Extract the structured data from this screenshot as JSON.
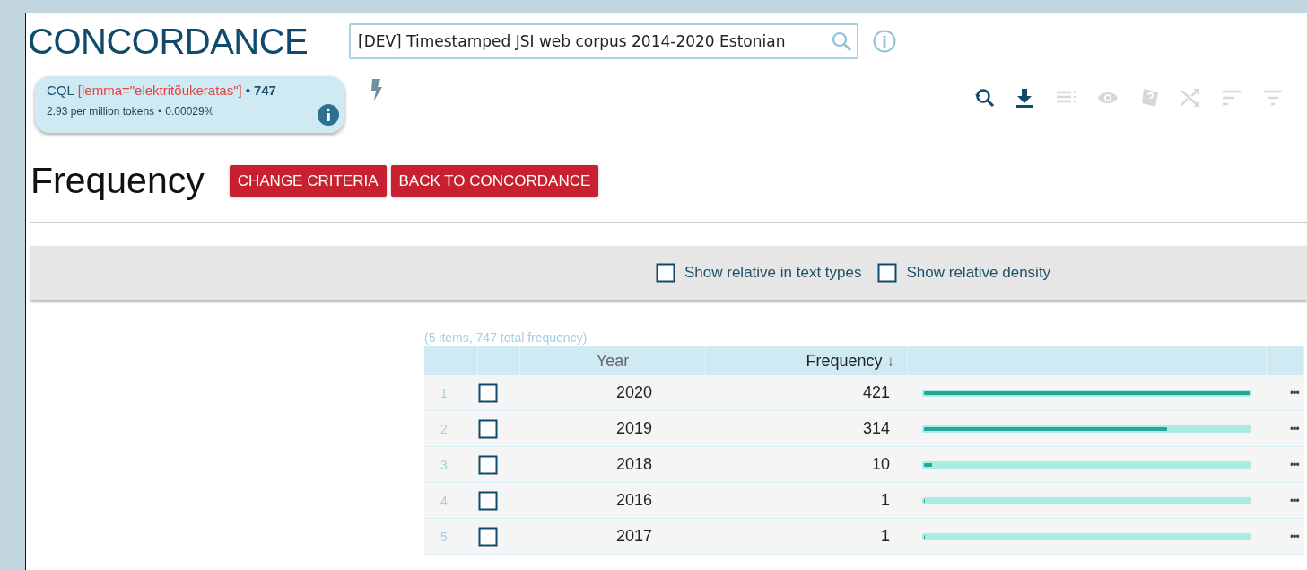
{
  "app": {
    "title": "CONCORDANCE"
  },
  "corpus_search": {
    "value": "[DEV] Timestamped JSI web corpus 2014-2020 Estonian"
  },
  "query": {
    "label": "CQL",
    "expression": "[lemma=\"elektritõukeratas\"]",
    "separator": "•",
    "hits": "747",
    "per_million": "2.93 per million tokens",
    "separator_2": "•",
    "percent": "0.00029%"
  },
  "toolbar": [
    {
      "kind": "refine",
      "disabled": false
    },
    {
      "kind": "download",
      "disabled": false
    },
    {
      "kind": "lines",
      "disabled": true
    },
    {
      "kind": "view",
      "disabled": true
    },
    {
      "kind": "random",
      "disabled": true
    },
    {
      "kind": "shuffle",
      "disabled": true
    },
    {
      "kind": "sort",
      "disabled": true
    },
    {
      "kind": "filter",
      "disabled": true
    }
  ],
  "page": {
    "title": "Frequency",
    "buttons": [
      "CHANGE CRITERIA",
      "BACK TO CONCORDANCE"
    ]
  },
  "options": [
    {
      "label": "Show relative in text types",
      "checked": false
    },
    {
      "label": "Show relative density",
      "checked": false
    }
  ],
  "table": {
    "summary": "(5 items, 747 total frequency)",
    "columns": [
      {
        "label": "Year"
      },
      {
        "label": "Frequency",
        "sort": "↓"
      }
    ],
    "rows": [
      {
        "index": "1",
        "checked": false,
        "year": "2020",
        "frequency": "421",
        "level": 1,
        "menu": "•••"
      },
      {
        "index": "2",
        "checked": false,
        "year": "2019",
        "frequency": "314",
        "level": 0.746,
        "menu": "•••"
      },
      {
        "index": "3",
        "checked": false,
        "year": "2018",
        "frequency": "10",
        "level": 0.024,
        "menu": "•••"
      },
      {
        "index": "4",
        "checked": false,
        "year": "2016",
        "frequency": "1",
        "level": 0.0024,
        "menu": "•••"
      },
      {
        "index": "5",
        "checked": false,
        "year": "2017",
        "frequency": "1",
        "level": 0.0024,
        "menu": "•••"
      }
    ]
  }
}
